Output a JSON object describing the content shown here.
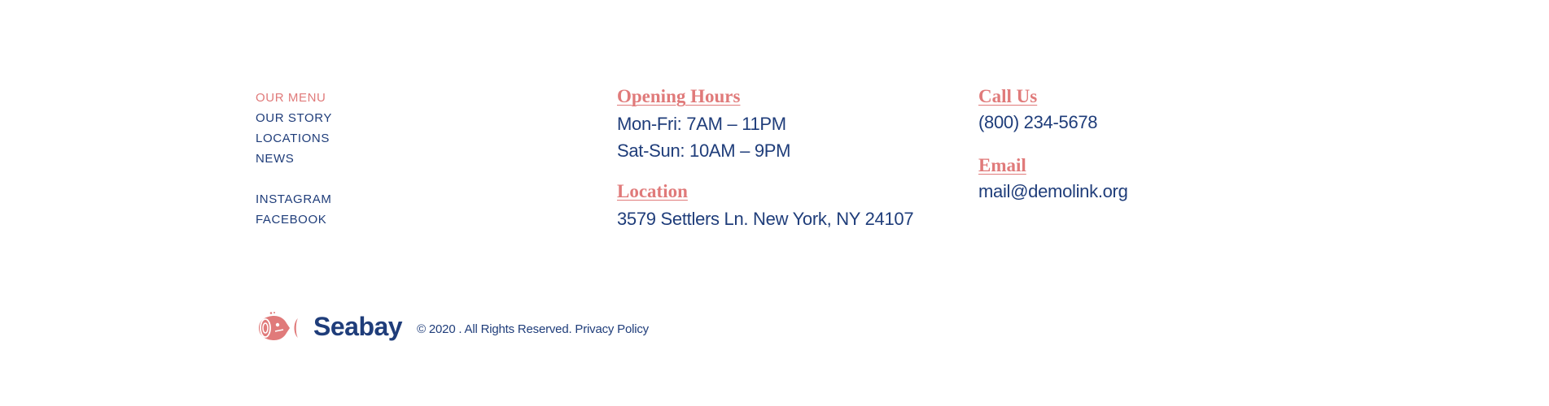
{
  "nav": {
    "primary": [
      {
        "label": "OUR MENU",
        "active": true
      },
      {
        "label": "OUR STORY",
        "active": false
      },
      {
        "label": "LOCATIONS",
        "active": false
      },
      {
        "label": "NEWS",
        "active": false
      }
    ],
    "social": [
      {
        "label": "INSTAGRAM"
      },
      {
        "label": "FACEBOOK"
      }
    ]
  },
  "hours": {
    "heading": "Opening Hours",
    "weekdays": "Mon-Fri: 7AM – 11PM",
    "weekend": "Sat-Sun: 10AM – 9PM"
  },
  "location": {
    "heading": "Location",
    "address": "3579 Settlers Ln. New York, NY 24107"
  },
  "call": {
    "heading": "Call Us",
    "phone": "(800) 234-5678"
  },
  "email": {
    "heading": "Email",
    "address": "mail@demolink.org"
  },
  "footer": {
    "brand": "Seabay",
    "copyright": "© 2020 . All Rights Reserved.",
    "privacy": "Privacy Policy",
    "logo_icon": "fish-icon"
  },
  "colors": {
    "accent": "#e07a7a",
    "primary": "#1f3d7a",
    "background": "#ffffff"
  }
}
